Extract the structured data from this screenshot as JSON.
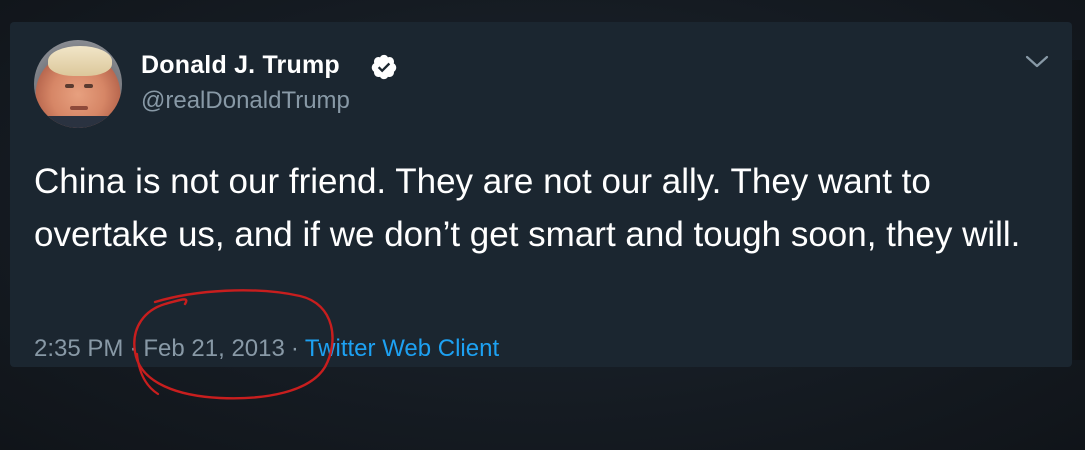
{
  "tweet": {
    "author": {
      "display_name": "Donald J. Trump",
      "handle": "@realDonaldTrump",
      "verified": true,
      "avatar_icon": "profile-photo"
    },
    "text": "China is not our friend. They are not our ally. They want to overtake us, and if we don’t get smart and tough soon, they will.",
    "time": "2:35 PM",
    "separator": "·",
    "date": "Feb 21, 2013",
    "source": "Twitter Web Client"
  },
  "colors": {
    "background": "#1b2630",
    "text": "#ffffff",
    "secondary": "#8899a6",
    "link": "#1da1f2",
    "annotation": "#c81e1e"
  },
  "icons": {
    "verified": "verified-badge-icon",
    "menu": "chevron-down-icon"
  }
}
